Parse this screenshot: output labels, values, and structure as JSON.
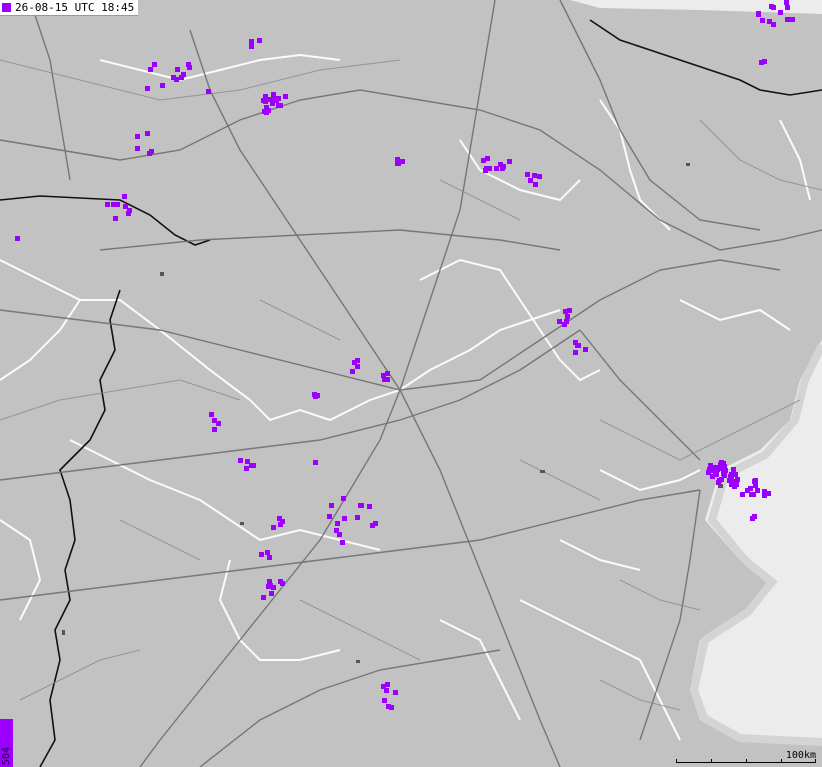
{
  "header": {
    "timestamp": "26-08-15 UTC 18:45"
  },
  "legend": {
    "count": "504",
    "strike_color": "#9b00ff"
  },
  "scale": {
    "label": "100km"
  },
  "icons": {
    "legend_swatch": "square-icon"
  }
}
